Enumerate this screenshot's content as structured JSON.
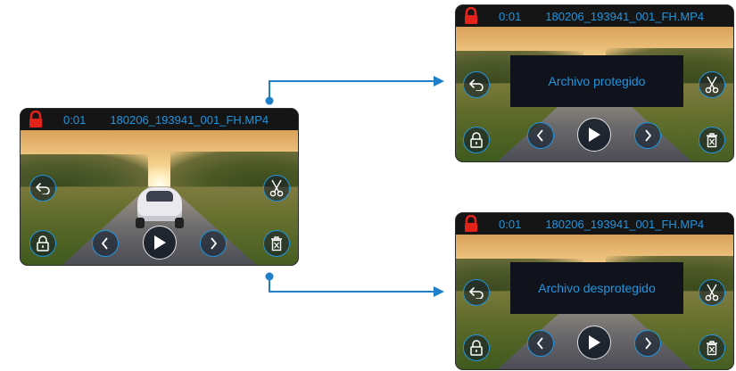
{
  "screens": {
    "main": {
      "time": "0:01",
      "filename": "180206_193941_001_FH.MP4"
    },
    "protected": {
      "time": "0:01",
      "filename": "180206_193941_001_FH.MP4",
      "message": "Archivo protegido"
    },
    "unprotected": {
      "time": "0:01",
      "filename": "180206_193941_001_FH.MP4",
      "message": "Archivo desprotegido"
    }
  },
  "colors": {
    "accent": "#1f95e0",
    "lock_red": "#e3231b",
    "topbar": "#151515",
    "connector": "#1f7fc9"
  },
  "icons": {
    "lock_status": "padlock-red-icon",
    "back": "back-arrow-icon",
    "cut": "scissors-icon",
    "protect": "padlock-toggle-icon",
    "prev": "chevron-left-icon",
    "play": "play-icon",
    "next": "chevron-right-icon",
    "delete": "trash-icon"
  }
}
